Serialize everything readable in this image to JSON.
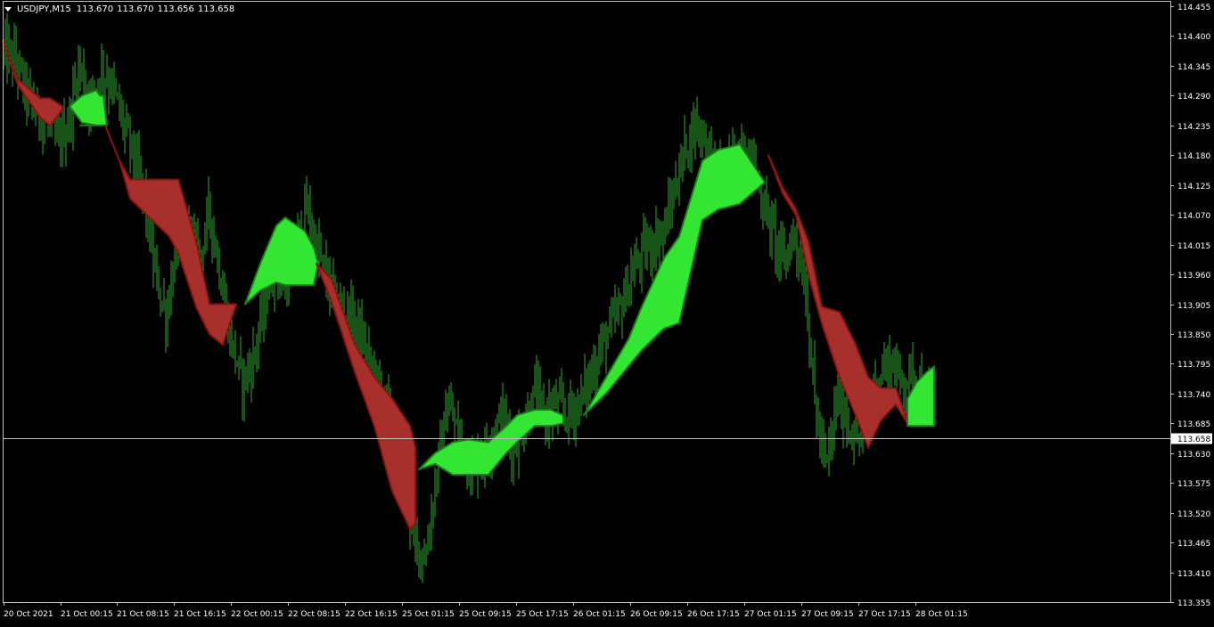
{
  "header": {
    "symbol_tf": "USDJPY,M15",
    "quote_1": "113.670",
    "quote_2": "113.670",
    "quote_3": "113.656",
    "quote_4": "113.658"
  },
  "colors": {
    "background": "#000000",
    "axis": "#c0c0c0",
    "text": "#ffffff",
    "bars": "#2fa82f",
    "bull_band": "#32e632",
    "bear_band": "#a8302c",
    "bull_edge": "#1f7a1f",
    "bear_edge": "#8c1410",
    "price_line": "#c0c0c0"
  },
  "chart_data": {
    "type": "ohlc-candles",
    "symbol": "USDJPY",
    "timeframe": "M15",
    "ylim": [
      113.355,
      114.455
    ],
    "y_ticks": [
      "114.455",
      "114.400",
      "114.345",
      "114.290",
      "114.235",
      "114.180",
      "114.125",
      "114.070",
      "114.015",
      "113.960",
      "113.905",
      "113.850",
      "113.795",
      "113.740",
      "113.685",
      "113.630",
      "113.575",
      "113.520",
      "113.465",
      "113.410",
      "113.355"
    ],
    "x_ticks": [
      "20 Oct 2021",
      "21 Oct 00:15",
      "21 Oct 08:15",
      "21 Oct 16:15",
      "22 Oct 00:15",
      "22 Oct 08:15",
      "22 Oct 16:15",
      "25 Oct 01:15",
      "25 Oct 09:15",
      "25 Oct 17:15",
      "26 Oct 01:15",
      "26 Oct 09:15",
      "26 Oct 17:15",
      "27 Oct 01:15",
      "27 Oct 09:15",
      "27 Oct 17:15",
      "28 Oct 01:15"
    ],
    "current_price": "113.658",
    "close_path": [
      114.37,
      114.36,
      114.3,
      114.26,
      114.24,
      114.2,
      114.24,
      114.35,
      114.28,
      114.34,
      114.31,
      114.24,
      114.18,
      114.1,
      113.96,
      113.88,
      114.02,
      114.05,
      113.98,
      114.08,
      113.96,
      113.84,
      113.76,
      113.8,
      113.9,
      113.98,
      113.94,
      114.02,
      114.08,
      114.0,
      113.94,
      113.9,
      113.88,
      113.84,
      113.78,
      113.74,
      113.68,
      113.58,
      113.46,
      113.44,
      113.6,
      113.72,
      113.66,
      113.6,
      113.62,
      113.66,
      113.7,
      113.64,
      113.68,
      113.74,
      113.7,
      113.72,
      113.7,
      113.72,
      113.76,
      113.82,
      113.86,
      113.9,
      113.96,
      114.0,
      114.02,
      114.04,
      114.12,
      114.2,
      114.24,
      114.2,
      114.14,
      114.16,
      114.2,
      114.18,
      114.1,
      114.04,
      113.98,
      114.04,
      113.94,
      113.7,
      113.6,
      113.74,
      113.68,
      113.66,
      113.72,
      113.78,
      113.8,
      113.76,
      113.78,
      113.74,
      113.7
    ],
    "bands": [
      {
        "trend": "bear",
        "x": [
          3,
          20,
          45,
          56,
          70
        ],
        "top": [
          114.39,
          114.32,
          114.285,
          114.285,
          114.27
        ],
        "bot": [
          114.39,
          114.31,
          114.25,
          114.235,
          114.265
        ]
      },
      {
        "trend": "bull",
        "x": [
          78,
          92,
          108,
          112,
          116,
          120,
          90
        ],
        "top": [
          114.27,
          114.29,
          114.3,
          114.29,
          114.29,
          114.235,
          114.235
        ],
        "bot": [
          114.27,
          114.24,
          114.235,
          114.235,
          114.235,
          114.235,
          114.235
        ]
      },
      {
        "trend": "bear",
        "x": [
          118,
          134,
          146,
          190,
          200,
          220,
          235,
          250,
          265
        ],
        "top": [
          114.235,
          114.17,
          114.135,
          114.135,
          114.135,
          114.02,
          113.905,
          113.905,
          113.905
        ],
        "bot": [
          114.235,
          114.17,
          114.1,
          114.03,
          114.0,
          113.9,
          113.85,
          113.83,
          113.905
        ]
      },
      {
        "trend": "bull",
        "x": [
          275,
          292,
          310,
          320,
          342,
          352,
          357
        ],
        "top": [
          113.905,
          113.98,
          114.05,
          114.065,
          114.04,
          114.01,
          113.98
        ],
        "bot": [
          113.905,
          113.93,
          113.945,
          113.94,
          113.94,
          113.94,
          113.98
        ]
      },
      {
        "trend": "bear",
        "x": [
          355,
          372,
          398,
          420,
          440,
          460,
          466
        ],
        "top": [
          113.98,
          113.95,
          113.83,
          113.77,
          113.73,
          113.68,
          113.64
        ],
        "bot": [
          113.98,
          113.91,
          113.78,
          113.68,
          113.56,
          113.49,
          113.5
        ]
      },
      {
        "trend": "bull",
        "x": [
          470,
          488,
          508,
          525,
          548,
          568,
          580,
          600,
          618,
          632
        ],
        "top": [
          113.6,
          113.63,
          113.65,
          113.655,
          113.65,
          113.68,
          113.7,
          113.71,
          113.71,
          113.7
        ],
        "bot": [
          113.6,
          113.61,
          113.59,
          113.59,
          113.59,
          113.63,
          113.65,
          113.68,
          113.68,
          113.685
        ]
      },
      {
        "trend": "bull",
        "x": [
          655,
          680,
          705,
          720,
          745,
          762,
          788,
          806,
          830,
          858
        ],
        "top": [
          113.7,
          113.77,
          113.84,
          113.9,
          113.99,
          114.03,
          114.17,
          114.19,
          114.2,
          114.13
        ],
        "bot": [
          113.7,
          113.74,
          113.79,
          113.82,
          113.86,
          113.87,
          114.06,
          114.08,
          114.09,
          114.13
        ]
      },
      {
        "trend": "bear",
        "x": [
          862,
          878,
          893,
          907,
          922,
          942,
          960,
          974,
          988,
          1005,
          1020
        ],
        "top": [
          114.18,
          114.12,
          114.08,
          114.02,
          113.9,
          113.89,
          113.83,
          113.77,
          113.75,
          113.75,
          113.68
        ],
        "bot": [
          114.18,
          114.11,
          114.07,
          113.96,
          113.87,
          113.77,
          113.7,
          113.64,
          113.69,
          113.72,
          113.68
        ]
      },
      {
        "trend": "bull",
        "x": [
          1018,
          1028,
          1040,
          1048
        ],
        "top": [
          113.73,
          113.76,
          113.78,
          113.79
        ],
        "bot": [
          113.68,
          113.68,
          113.68,
          113.68
        ]
      }
    ]
  }
}
